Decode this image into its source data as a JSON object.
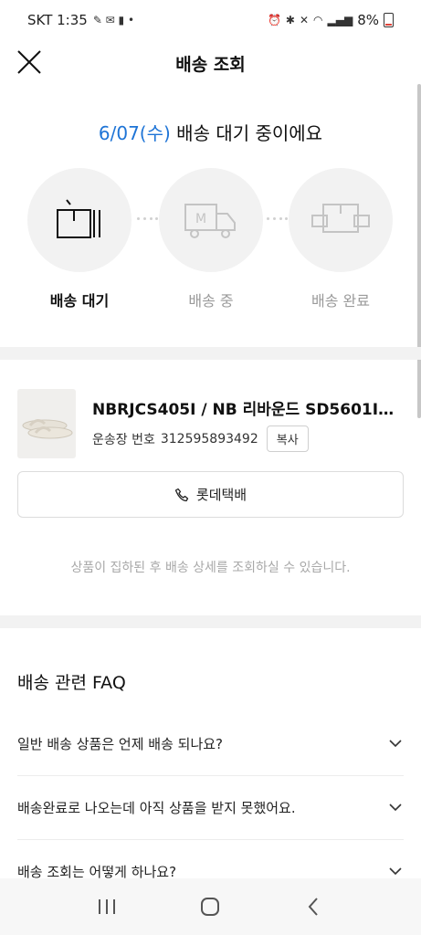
{
  "status_bar": {
    "carrier_time": "SKT 1:35",
    "battery": "8%",
    "icons": [
      "notification-icons",
      "alarm-icon",
      "bluetooth-icon",
      "mute-icon",
      "wifi-icon",
      "signal-icon",
      "battery-icon"
    ]
  },
  "header": {
    "title": "배송 조회",
    "close_icon": "close-icon"
  },
  "headline": {
    "date": "6/07(수)",
    "text": " 배송 대기 중이에요"
  },
  "steps": [
    {
      "label": "배송 대기",
      "icon": "box-icon",
      "active": true
    },
    {
      "label": "배송 중",
      "icon": "truck-icon",
      "active": false
    },
    {
      "label": "배송 완료",
      "icon": "handover-box-icon",
      "active": false
    }
  ],
  "product": {
    "name": "NBRJCS405I / NB 리바운드 SD5601IV...",
    "tracking_label": "운송장 번호",
    "tracking_number": "312595893492",
    "copy_label": "복사"
  },
  "courier": {
    "label": "롯데택배",
    "icon": "phone-icon"
  },
  "notice": "상품이 집하된 후 배송 상세를 조회하실 수 있습니다.",
  "faq": {
    "title": "배송 관련 FAQ",
    "items": [
      {
        "question": "일반 배송 상품은 언제 배송 되나요?"
      },
      {
        "question": "배송완료로 나오는데 아직 상품을 받지 못했어요."
      },
      {
        "question": "배송 조회는 어떻게 하나요?"
      }
    ]
  },
  "colors": {
    "accent": "#1e74d6",
    "inactive_text": "#9a9a9a",
    "step_bg": "#f2f2f2"
  }
}
